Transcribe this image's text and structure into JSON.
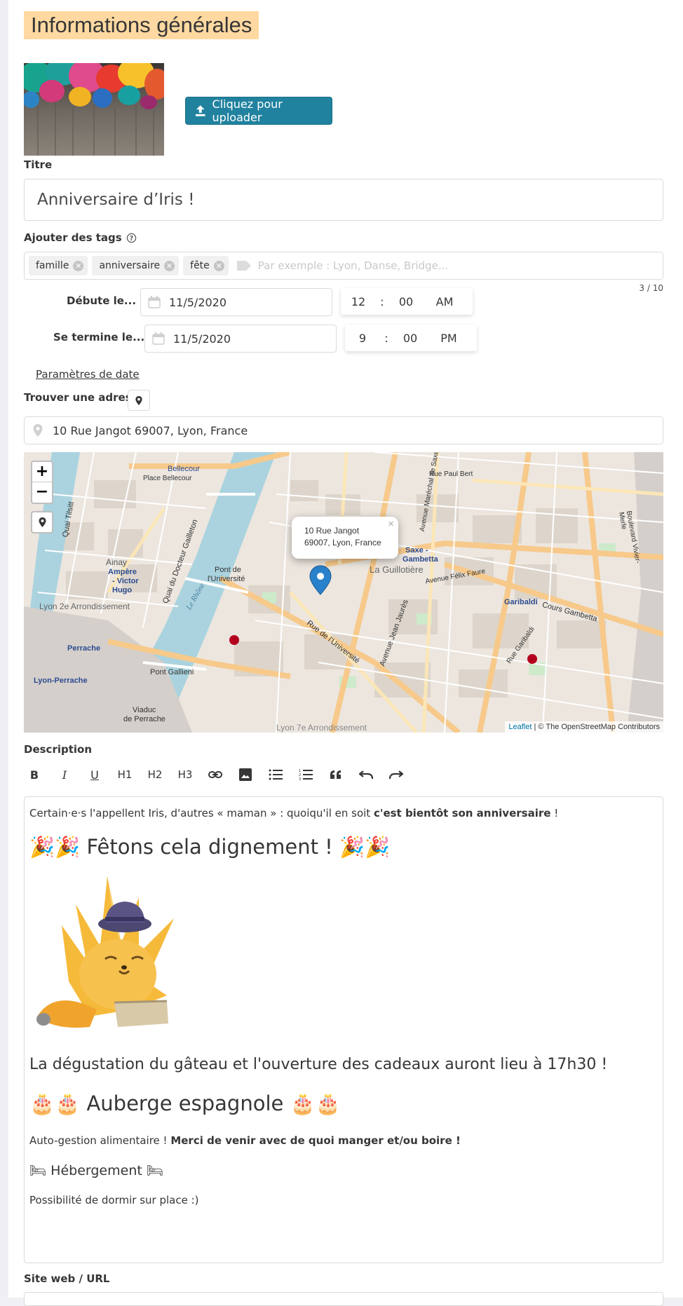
{
  "section": {
    "title": "Informations générales"
  },
  "upload": {
    "label": "Cliquez pour uploader",
    "icon": "upload-icon"
  },
  "title_field": {
    "label": "Titre",
    "value": "Anniversaire d’Iris !"
  },
  "tags": {
    "label": "Ajouter des tags",
    "help_icon": "help-icon",
    "items": [
      "famille",
      "anniversaire",
      "fête"
    ],
    "placeholder": "Par exemple : Lyon, Danse, Bridge...",
    "counter": "3 / 10"
  },
  "start": {
    "label": "Débute le...",
    "date": "11/5/2020",
    "hour": "12",
    "sep": ":",
    "minute": "00",
    "ampm": "AM"
  },
  "end": {
    "label": "Se termine le...",
    "date": "11/5/2020",
    "hour": "9",
    "sep": ":",
    "minute": "00",
    "ampm": "PM"
  },
  "date_params": "Paramètres de date",
  "address": {
    "label": "Trouver une adresse",
    "value": "10 Rue Jangot 69007, Lyon, France"
  },
  "map": {
    "zoom_in": "+",
    "zoom_out": "−",
    "popup_line1": "10 Rue Jangot",
    "popup_line2": "69007, Lyon, France",
    "popup_close": "×",
    "attribution_link": "Leaflet",
    "attribution_text": " | © The OpenStreetMap Contributors",
    "labels": [
      "Bellecour",
      "Place Bellecour",
      "Ainay",
      "Ampère",
      "- Victor",
      "Hugo",
      "Lyon 2e Arrondissement",
      "Perrache",
      "Lyon-Perrache",
      "Pont de",
      "l'Université",
      "Pont Gallieni",
      "Viaduc",
      "de Perrache",
      "La Guillotière",
      "Saxe -",
      "Gambetta",
      "Garibaldi",
      "Cours Gambetta",
      "Rue de l'Université",
      "Avenue Jean Jaurès",
      "Lyon 7e Arrondissement",
      "Le Rhône",
      "Quai du Docteur Gailleton",
      "Quai Tilsitt",
      "Boulevard Vivier-Merle",
      "Rue Paul Bert",
      "Avenue Félix Faure",
      "Rue Garibaldi",
      "Avenue Maréchal de Saxe"
    ]
  },
  "description": {
    "label": "Description",
    "toolbar": [
      "B",
      "I",
      "U",
      "H1",
      "H2",
      "H3"
    ],
    "para1_start": "Certain·e·s l'appellent Iris, d'autres « maman » : quoiqu'il en soit ",
    "para1_bold": "c'est bientôt son anniversaire",
    "para1_end": " !",
    "heading1": "Fêtons cela dignement !",
    "heading1_emoji": "🎉🎉",
    "para2": "La dégustation du gâteau et l'ouverture des cadeaux auront lieu à 17h30 !",
    "heading2": "Auberge espagnole",
    "heading2_emoji": "🎂🎂",
    "para3_start": "Auto-gestion alimentaire ! ",
    "para3_bold": "Merci de venir avec de quoi manger et/ou boire !",
    "heading3": "Hébergement",
    "heading3_emoji": "🛏",
    "para4": "Possibilité de dormir sur place :)"
  },
  "site": {
    "label": "Site web / URL"
  },
  "colors": {
    "accent": "#21829f",
    "section_highlight": "#ffd9a1",
    "pin": "#2a81cb"
  }
}
